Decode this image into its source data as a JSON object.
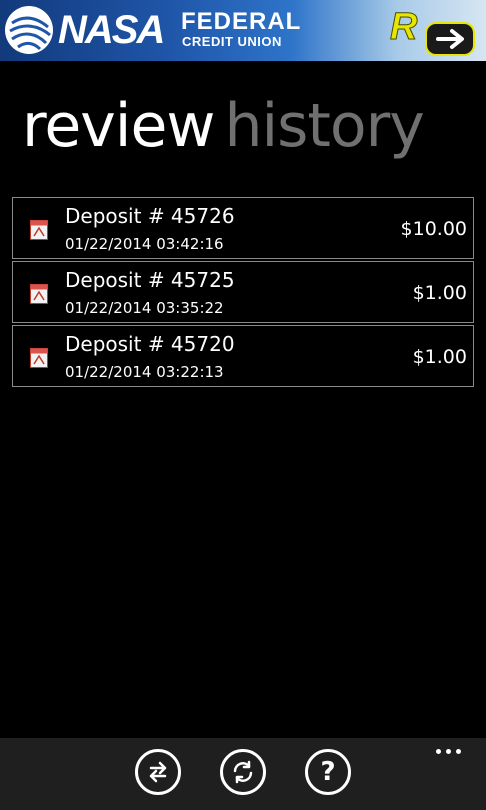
{
  "header": {
    "brand_primary": "NASA",
    "brand_secondary": "FEDERAL",
    "brand_tagline": "CREDIT UNION",
    "app_logo_icon": "rd-logo-icon",
    "colors": {
      "banner_dark": "#123a7c",
      "banner_light": "#d6e6f2",
      "rd_accent": "#e6e600"
    }
  },
  "pivot": {
    "tabs": [
      {
        "label": "review",
        "active": true
      },
      {
        "label": "history",
        "active": false
      }
    ]
  },
  "deposits": [
    {
      "title": "Deposit # 45726",
      "datetime": "01/22/2014 03:42:16",
      "amount": "$10.00",
      "icon": "pdf-document-icon"
    },
    {
      "title": "Deposit # 45725",
      "datetime": "01/22/2014 03:35:22",
      "amount": "$1.00",
      "icon": "pdf-document-icon"
    },
    {
      "title": "Deposit # 45720",
      "datetime": "01/22/2014 03:22:13",
      "amount": "$1.00",
      "icon": "pdf-document-icon"
    }
  ],
  "app_bar": {
    "buttons": [
      {
        "icon": "swap-arrows-icon"
      },
      {
        "icon": "refresh-icon"
      },
      {
        "icon": "help-icon",
        "glyph": "?"
      }
    ],
    "more_icon": "ellipsis-icon",
    "colors": {
      "background": "#1f1f1f"
    }
  }
}
